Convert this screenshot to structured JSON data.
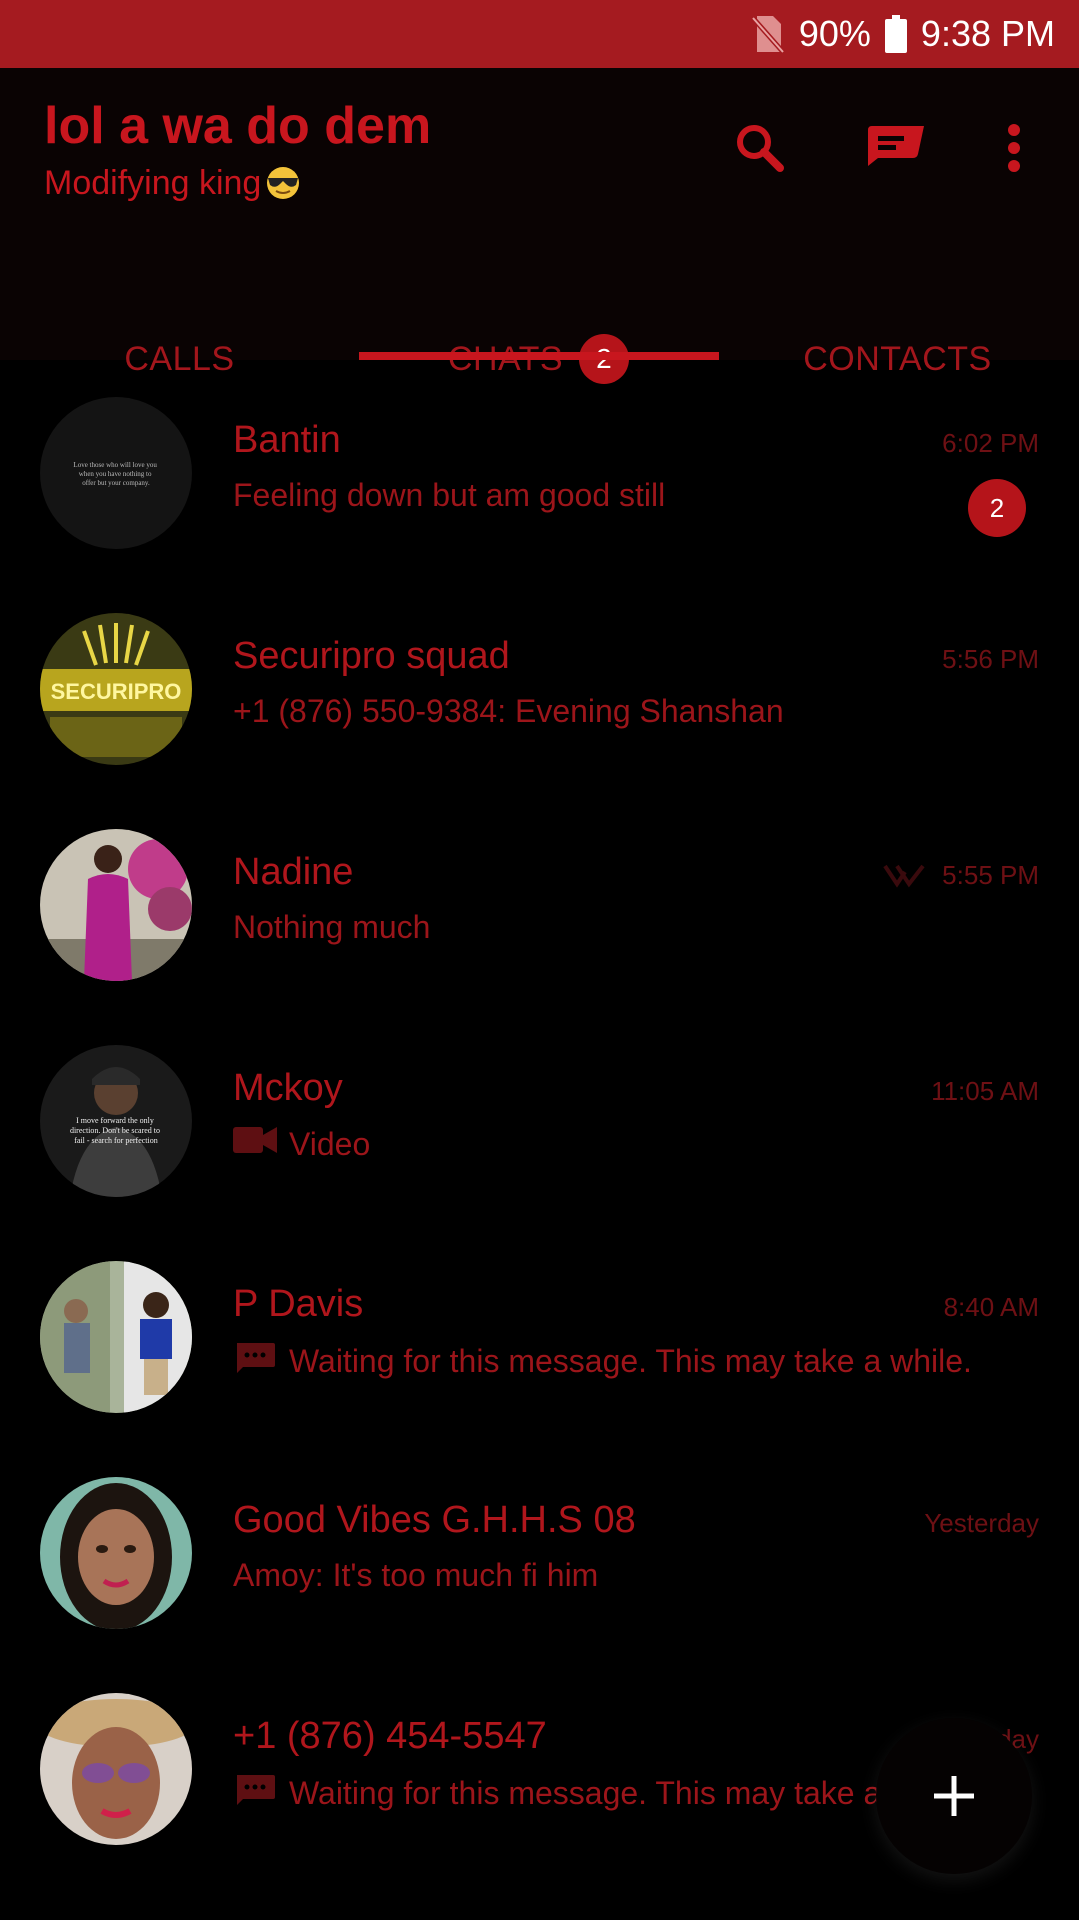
{
  "status_bar": {
    "battery": "90%",
    "time": "9:38 PM"
  },
  "header": {
    "title": "lol a wa do dem",
    "subtitle": "Modifying king",
    "search_icon": "search-icon",
    "compose_icon": "new-message-icon",
    "menu_icon": "more-vert-icon"
  },
  "tabs": [
    {
      "label": "CALLS"
    },
    {
      "label": "CHATS",
      "badge": "2"
    },
    {
      "label": "CONTACTS"
    }
  ],
  "chats": [
    {
      "name": "Bantin",
      "time": "6:02 PM",
      "preview": "Feeling down but am good still",
      "unread": "2"
    },
    {
      "name": "Securipro squad",
      "time": "5:56 PM",
      "preview": "+1 (876) 550-9384: Evening Shanshan"
    },
    {
      "name": "Nadine",
      "time": "5:55 PM",
      "preview": "Nothing much"
    },
    {
      "name": "Mckoy",
      "time": "11:05 AM",
      "preview": "Video"
    },
    {
      "name": "P Davis",
      "time": "8:40 AM",
      "preview": "Waiting for this message. This may take a while."
    },
    {
      "name": "Good Vibes G.H.H.S 08",
      "time": "Yesterday",
      "preview": "Amoy: It's too much fi him"
    },
    {
      "name": "+1 (876) 454-5547",
      "time": "Yesterday",
      "preview": "Waiting for this message. This may take a while."
    }
  ],
  "avatar_texts": {
    "bantin": "Love those who will love you when you have nothing to offer but your company.",
    "securipro": "SECURIPRO",
    "mckoy": "I move forward the only direction. Don't be scared to fail - search for perfection"
  },
  "fab": {
    "icon": "plus-icon"
  },
  "colors": {
    "status_bar": "#a51b20",
    "accent": "#c8161e",
    "background": "#000000"
  }
}
